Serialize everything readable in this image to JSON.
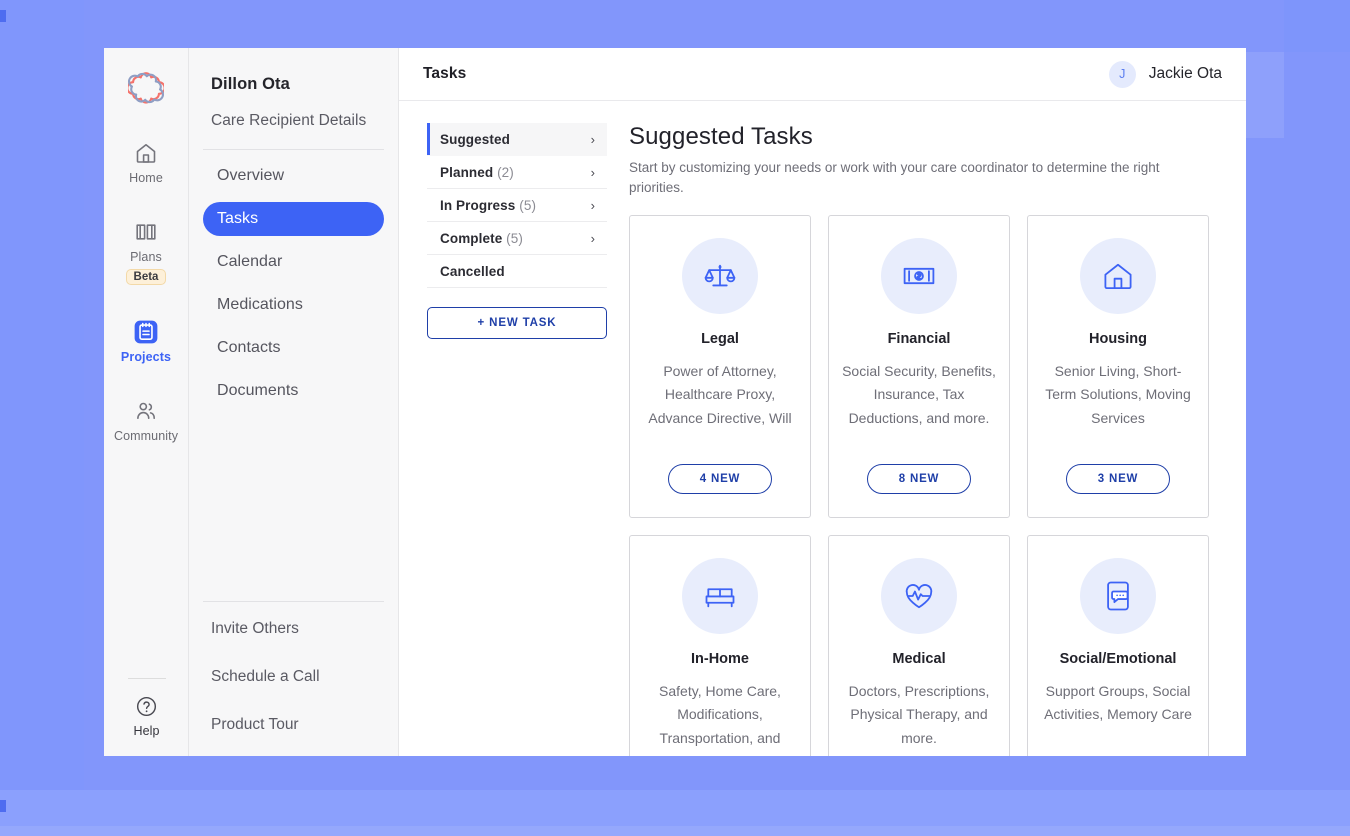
{
  "rail": {
    "logo_icon": "carebridge-flower-logo",
    "items": [
      {
        "label": "Home",
        "icon": "home-icon",
        "active": false
      },
      {
        "label": "Plans",
        "icon": "book-map-icon",
        "active": false,
        "badge": "Beta"
      },
      {
        "label": "Projects",
        "icon": "notepad-icon",
        "active": true
      },
      {
        "label": "Community",
        "icon": "people-icon",
        "active": false
      }
    ],
    "help": {
      "label": "Help",
      "icon": "question-circle-icon"
    }
  },
  "sidebar": {
    "title": "Dillon Ota",
    "details_link": "Care Recipient Details",
    "items": [
      {
        "label": "Overview",
        "active": false
      },
      {
        "label": "Tasks",
        "active": true
      },
      {
        "label": "Calendar",
        "active": false
      },
      {
        "label": "Medications",
        "active": false
      },
      {
        "label": "Contacts",
        "active": false
      },
      {
        "label": "Documents",
        "active": false
      }
    ],
    "footer": [
      {
        "label": "Invite Others"
      },
      {
        "label": "Schedule a Call"
      },
      {
        "label": "Product Tour"
      }
    ]
  },
  "topbar": {
    "title": "Tasks",
    "user_initial": "J",
    "user_name": "Jackie Ota"
  },
  "filters": {
    "items": [
      {
        "label": "Suggested",
        "count": "",
        "chevron": "›",
        "active": true
      },
      {
        "label": "Planned",
        "count": "(2)",
        "chevron": "›",
        "active": false
      },
      {
        "label": "In Progress",
        "count": "(5)",
        "chevron": "›",
        "active": false
      },
      {
        "label": "Complete",
        "count": "(5)",
        "chevron": "›",
        "active": false
      },
      {
        "label": "Cancelled",
        "count": "",
        "chevron": "",
        "active": false
      }
    ],
    "new_task_label": "+ NEW TASK"
  },
  "panel": {
    "title": "Suggested Tasks",
    "subtitle": "Start by customizing your needs or work with your care coordinator to determine the right priorities.",
    "cards": [
      {
        "icon": "scales-of-justice-icon",
        "title": "Legal",
        "desc": "Power of Attorney, Healthcare Proxy, Advance Directive, Will",
        "badge": "4 NEW"
      },
      {
        "icon": "banknote-dollar-icon",
        "title": "Financial",
        "desc": "Social Security, Benefits, Insurance, Tax Deductions, and more.",
        "badge": "8 NEW"
      },
      {
        "icon": "house-icon",
        "title": "Housing",
        "desc": "Senior Living, Short-Term Solutions, Moving Services",
        "badge": "3 NEW"
      },
      {
        "icon": "bed-icon",
        "title": "In-Home",
        "desc": "Safety, Home Care, Modifications, Transportation, and more.",
        "badge": ""
      },
      {
        "icon": "heart-pulse-icon",
        "title": "Medical",
        "desc": "Doctors, Prescriptions, Physical Therapy, and more.",
        "badge": ""
      },
      {
        "icon": "phone-chat-icon",
        "title": "Social/Emotional",
        "desc": "Support Groups, Social Activities, Memory Care",
        "badge": ""
      }
    ]
  },
  "colors": {
    "accent": "#3d63f5",
    "accent_dark": "#1f3fa8",
    "icon_bg": "#e8edfc",
    "desktop_bg": "#808ffa",
    "beta_bg": "#fdf0d9"
  }
}
